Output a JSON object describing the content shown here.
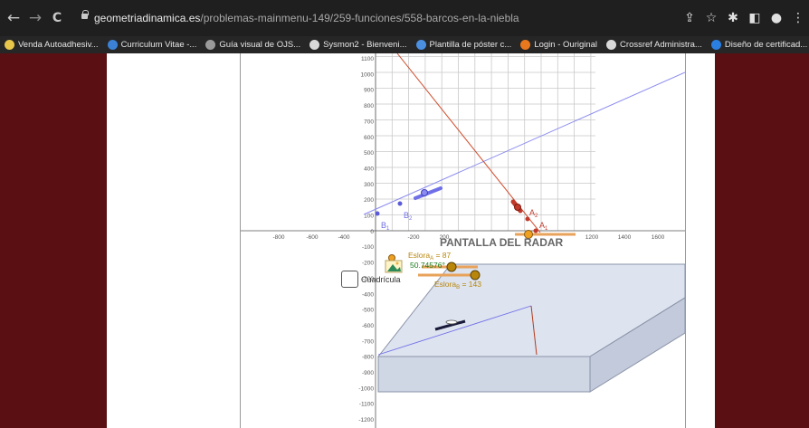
{
  "browser": {
    "url_host": "geometriadinamica.es",
    "url_path": "/problemas-mainmenu-149/259-funciones/558-barcos-en-la-niebla",
    "back_glyph": "←",
    "forward_glyph": "→",
    "reload_glyph": "C",
    "right_icons": [
      "share-icon",
      "star-icon",
      "extensions-icon",
      "sidepanel-icon",
      "profile-icon",
      "menu-icon"
    ],
    "bookmarks": [
      {
        "label": "Venda Autoadhesiv...",
        "color": "#e8c64a"
      },
      {
        "label": "Curriculum Vitae -...",
        "color": "#3b82d6"
      },
      {
        "label": "Guía visual de OJS...",
        "color": "#9a9a9a"
      },
      {
        "label": "Sysmon2 - Bienveni...",
        "color": "#d9d9d9"
      },
      {
        "label": "Plantilla de póster c...",
        "color": "#4a8fe0"
      },
      {
        "label": "Login - Ouriginal",
        "color": "#e8781e"
      },
      {
        "label": "Crossref Administra...",
        "color": "#d9d9d9"
      },
      {
        "label": "Diseño de certificad...",
        "color": "#2a7fe0"
      }
    ],
    "bookmarks_more": "»"
  },
  "applet": {
    "y_ticks": [
      "1100",
      "1000",
      "900",
      "800",
      "700",
      "600",
      "500",
      "400",
      "300",
      "200",
      "100",
      "0",
      "-100",
      "-200",
      "-300",
      "-400",
      "-500",
      "-600",
      "-700",
      "-800",
      "-900",
      "-1000",
      "-1100",
      "-1200"
    ],
    "x_ticks": [
      "-800",
      "-600",
      "-400",
      "-200",
      "200",
      "1200",
      "1400",
      "1600"
    ],
    "point_b1": "B",
    "point_b1_sub": "1",
    "point_b2": "B",
    "point_b2_sub": "2",
    "point_a1": "A",
    "point_a1_sub": "1",
    "point_a2": "A",
    "point_a2_sub": "2",
    "radar_title": "PANTALLA  DEL  RADAR",
    "slider_a_label": "Eslora",
    "slider_a_sub": "A",
    "slider_a_value": " = 87",
    "angle_value": "50.74576°",
    "slider_b_label": "Eslora",
    "slider_b_sub": "B",
    "slider_b_value": " = 143",
    "checkbox_label": "Cuadrícula",
    "colors": {
      "ship_a": "#c0392b",
      "ship_b": "#7b7bea",
      "slider": "#e8a25a",
      "radar_top": "#dde3ef",
      "radar_side": "#cfd6e4"
    }
  }
}
